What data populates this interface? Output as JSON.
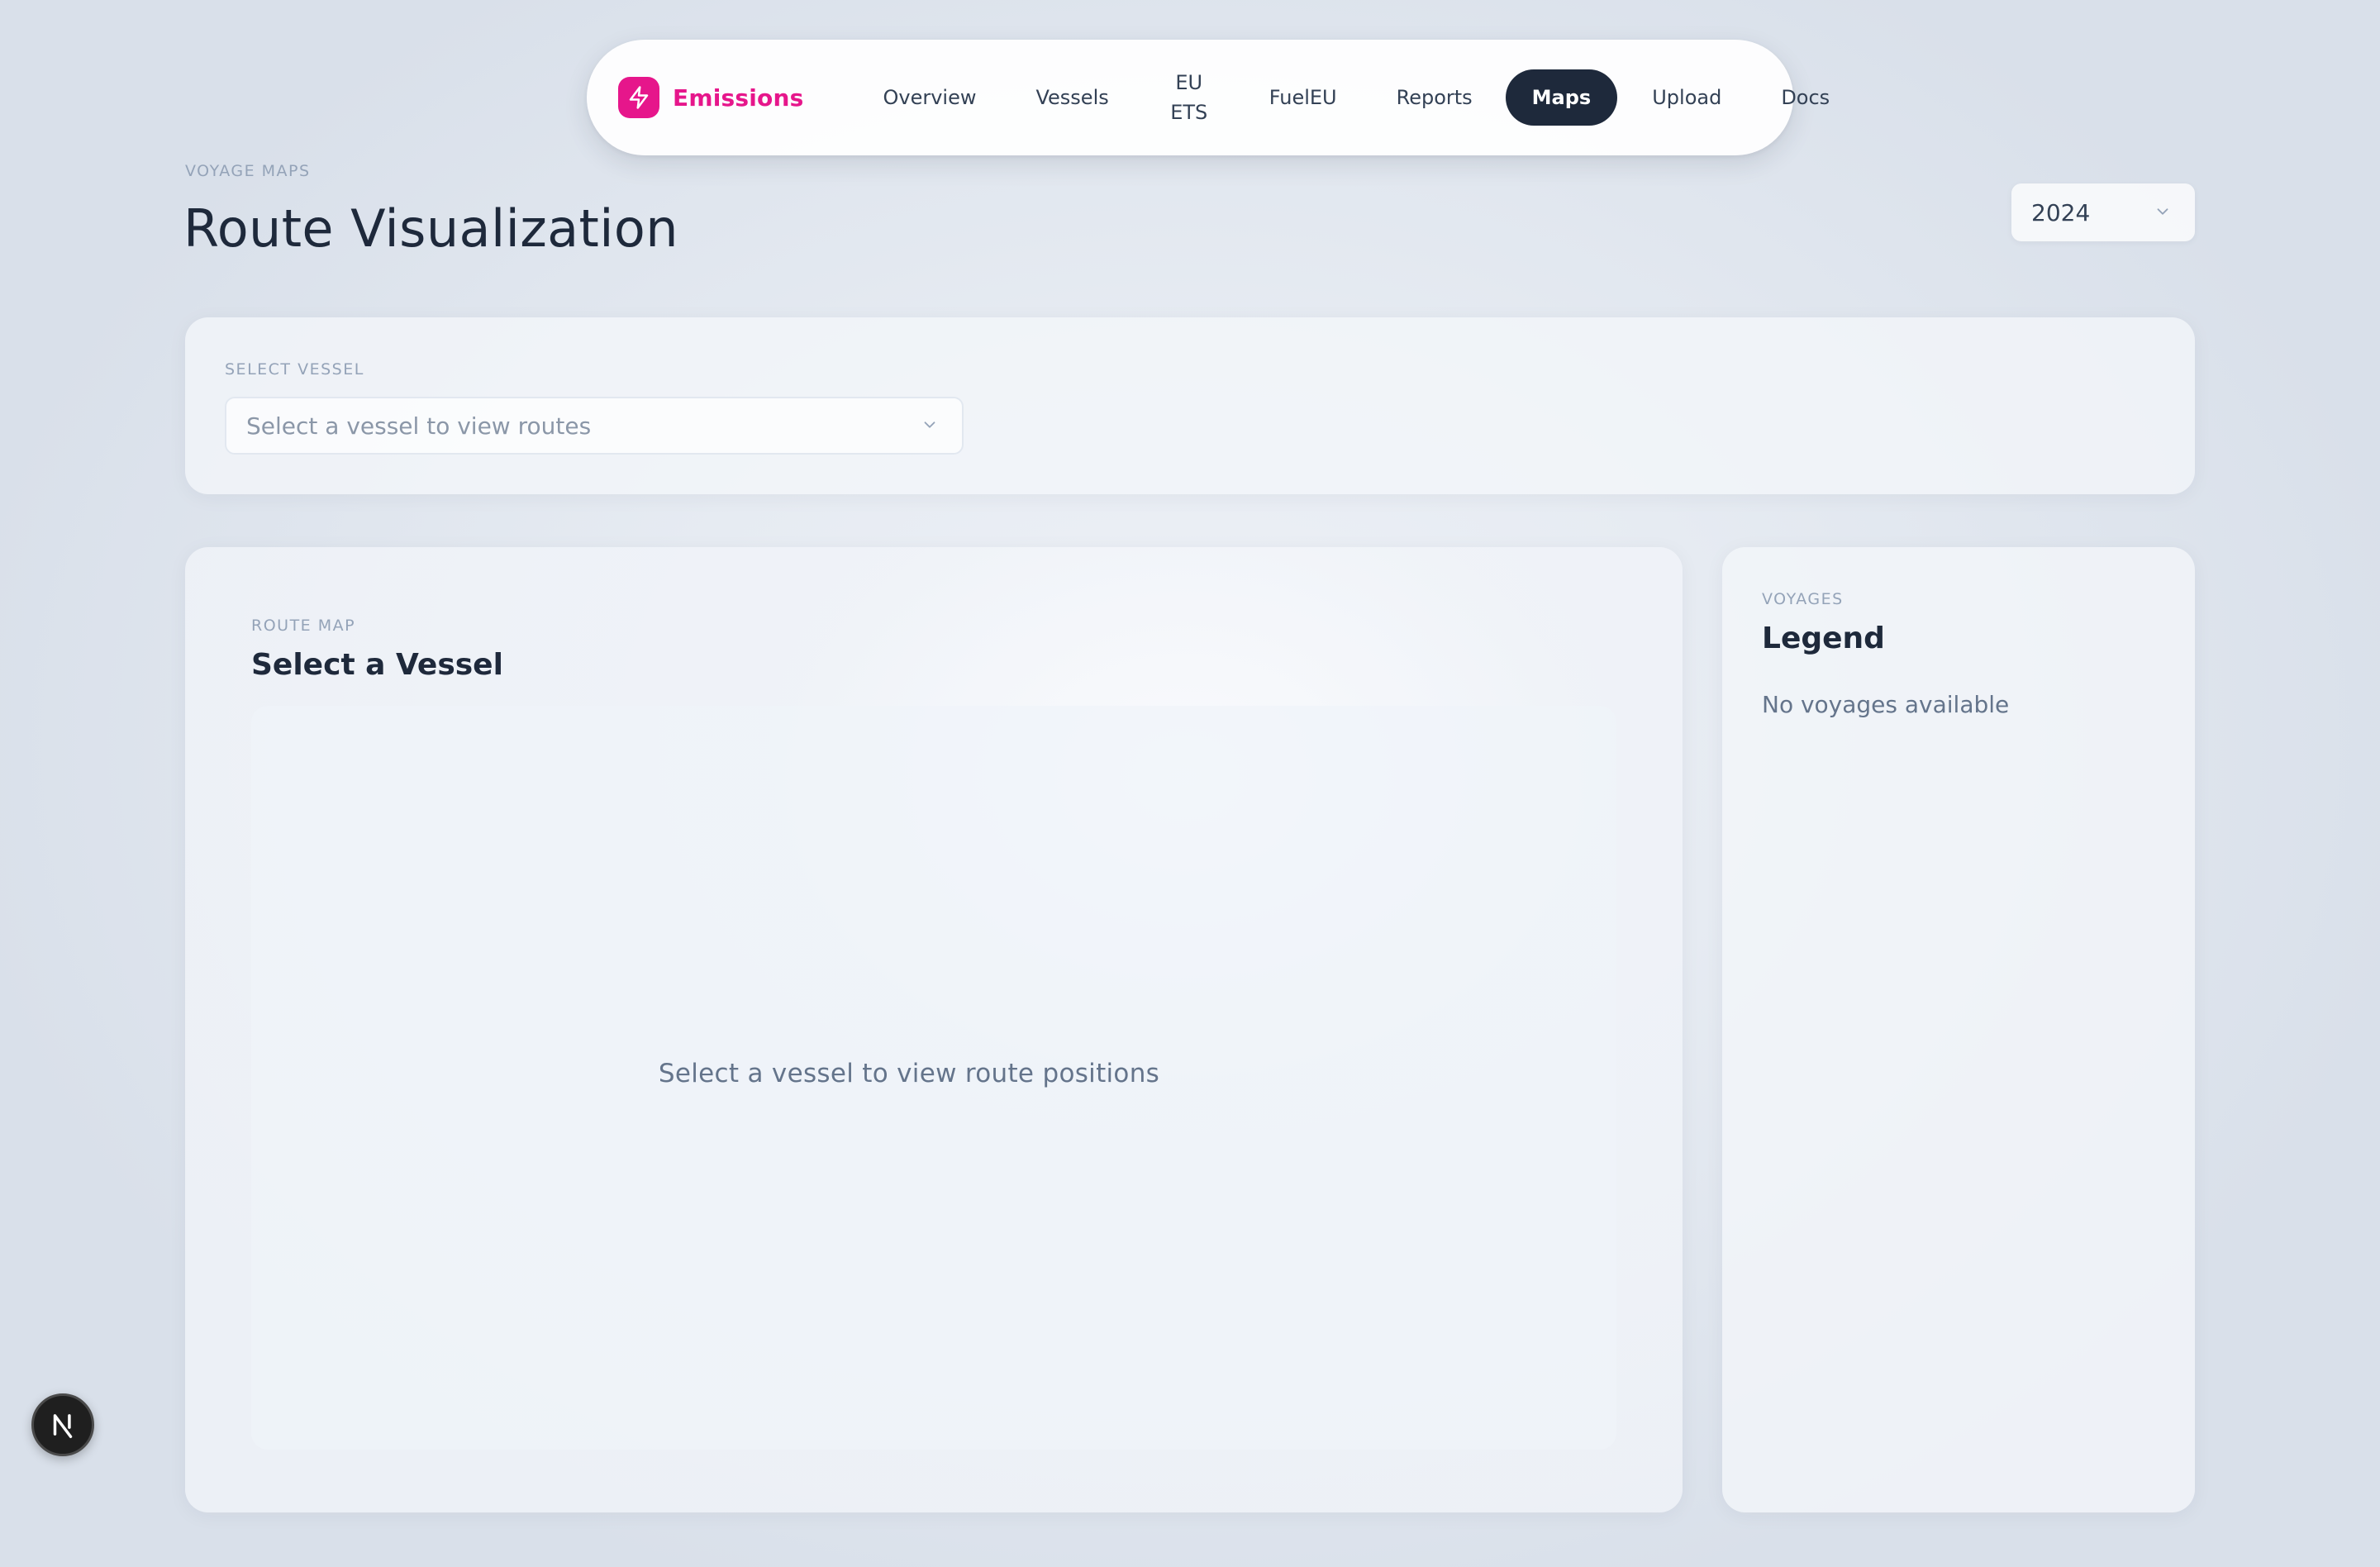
{
  "nav": {
    "brand": "Emissions",
    "items": [
      {
        "label": "Overview"
      },
      {
        "label": "Vessels"
      },
      {
        "label": "EU ETS"
      },
      {
        "label": "FuelEU"
      },
      {
        "label": "Reports"
      },
      {
        "label": "Maps",
        "active": true
      },
      {
        "label": "Upload"
      },
      {
        "label": "Docs"
      }
    ]
  },
  "header": {
    "eyebrow": "VOYAGE MAPS",
    "title": "Route Visualization",
    "year": "2024"
  },
  "vessel_selector": {
    "label": "SELECT VESSEL",
    "placeholder": "Select a vessel to view routes"
  },
  "route_map": {
    "eyebrow": "ROUTE MAP",
    "title": "Select a Vessel",
    "empty_message": "Select a vessel to view route positions"
  },
  "legend": {
    "eyebrow": "VOYAGES",
    "title": "Legend",
    "empty_message": "No voyages available"
  },
  "colors": {
    "brand": "#e6168b",
    "active_nav": "#1e293b"
  },
  "icons": {
    "brand": "lightning-icon",
    "dropdown": "chevron-down-icon",
    "badge": "nextjs-logo-icon"
  }
}
